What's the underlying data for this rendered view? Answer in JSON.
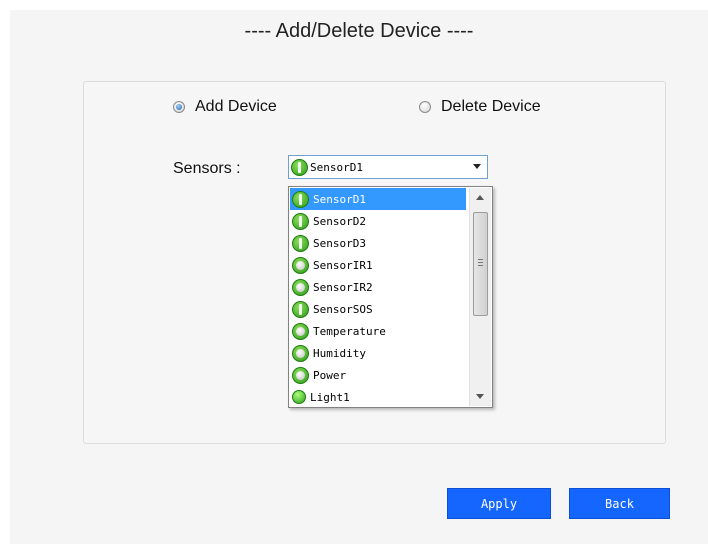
{
  "title": "---- Add/Delete Device ----",
  "mode": {
    "options": [
      {
        "label": "Add Device",
        "checked": true
      },
      {
        "label": "Delete Device",
        "checked": false
      }
    ]
  },
  "sensors": {
    "label": "Sensors :",
    "selected": "SensorD1",
    "options": [
      {
        "label": "SensorD1",
        "icon": "green-bar-icon"
      },
      {
        "label": "SensorD2",
        "icon": "green-bar-icon"
      },
      {
        "label": "SensorD3",
        "icon": "green-bar-icon"
      },
      {
        "label": "SensorIR1",
        "icon": "green-ring-icon"
      },
      {
        "label": "SensorIR2",
        "icon": "green-ring-icon"
      },
      {
        "label": "SensorSOS",
        "icon": "green-bar-icon"
      },
      {
        "label": "Temperature",
        "icon": "green-ring-icon"
      },
      {
        "label": "Humidity",
        "icon": "green-ring-icon"
      },
      {
        "label": "Power",
        "icon": "green-ring-icon"
      },
      {
        "label": "Light1",
        "icon": "green-dot-icon"
      }
    ]
  },
  "buttons": {
    "apply": "Apply",
    "back": "Back"
  },
  "colors": {
    "button_bg": "#1466ff",
    "selection_bg": "#3399ff",
    "panel_bg": "#f6f6f6"
  }
}
